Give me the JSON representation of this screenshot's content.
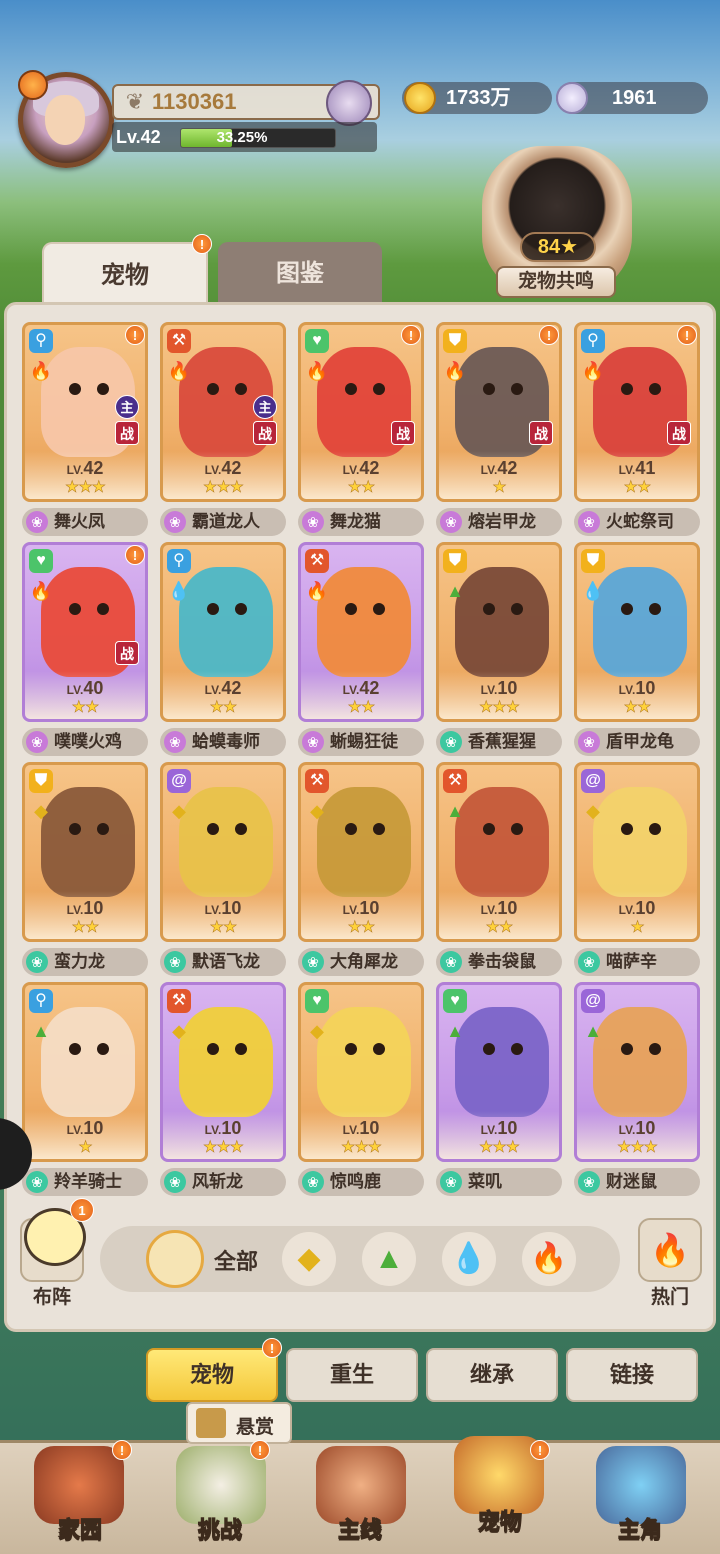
{
  "player": {
    "power": "1130361",
    "level_label": "Lv.42",
    "xp_percent_label": "33.25%",
    "xp_fraction": 0.3325
  },
  "currencies": {
    "gold": "1733万",
    "shell": "1961"
  },
  "resonance": {
    "level": "84★",
    "label": "宠物共鸣"
  },
  "tabs": {
    "pets": "宠物",
    "dex": "图鉴"
  },
  "pets": [
    {
      "name": "舞火凤",
      "level": "42",
      "stars": "★★★",
      "role": "key",
      "element": "fire",
      "zhu": "主",
      "zhan": "战",
      "purple": false,
      "badge": true,
      "body": "#f7c6a8"
    },
    {
      "name": "霸道龙人",
      "level": "42",
      "stars": "★★★",
      "role": "axe",
      "element": "fire",
      "zhu": "主",
      "zhan": "战",
      "purple": false,
      "badge": false,
      "body": "#d94b3c"
    },
    {
      "name": "舞龙猫",
      "level": "42",
      "stars": "★★",
      "role": "heart",
      "element": "fire",
      "zhu": "",
      "zhan": "战",
      "purple": false,
      "badge": true,
      "body": "#e2443a"
    },
    {
      "name": "熔岩甲龙",
      "level": "42",
      "stars": "★",
      "role": "shield",
      "element": "fire",
      "zhu": "",
      "zhan": "战",
      "purple": false,
      "badge": true,
      "body": "#6b5a55"
    },
    {
      "name": "火蛇祭司",
      "level": "41",
      "stars": "★★",
      "role": "key",
      "element": "fire",
      "zhu": "",
      "zhan": "战",
      "purple": false,
      "badge": true,
      "body": "#d9423c"
    },
    {
      "name": "噗噗火鸡",
      "level": "40",
      "stars": "★★",
      "role": "heart",
      "element": "fire",
      "zhu": "",
      "zhan": "战",
      "purple": true,
      "badge": true,
      "body": "#e94b3a"
    },
    {
      "name": "蛤蟆毒师",
      "level": "42",
      "stars": "★★",
      "role": "key",
      "element": "water",
      "zhu": "",
      "zhan": "",
      "purple": false,
      "badge": false,
      "body": "#4cb7c7"
    },
    {
      "name": "蜥蜴狂徒",
      "level": "42",
      "stars": "★★",
      "role": "axe",
      "element": "fire",
      "zhu": "",
      "zhan": "",
      "purple": true,
      "badge": false,
      "body": "#f08a3c"
    },
    {
      "name": "香蕉猩猩",
      "level": "10",
      "stars": "★★★",
      "role": "shield",
      "element": "grass",
      "zhu": "",
      "zhan": "",
      "purple": false,
      "badge": false,
      "body": "#7a4a38"
    },
    {
      "name": "盾甲龙龟",
      "level": "10",
      "stars": "★★",
      "role": "shield",
      "element": "water",
      "zhu": "",
      "zhan": "",
      "purple": false,
      "badge": false,
      "body": "#5aa7d8"
    },
    {
      "name": "蛮力龙",
      "level": "10",
      "stars": "★★",
      "role": "shield",
      "element": "earth",
      "zhu": "",
      "zhan": "",
      "purple": false,
      "badge": false,
      "body": "#8a5a3a"
    },
    {
      "name": "默语飞龙",
      "level": "10",
      "stars": "★★",
      "role": "spiral",
      "element": "earth",
      "zhu": "",
      "zhan": "",
      "purple": false,
      "badge": false,
      "body": "#e8c24a"
    },
    {
      "name": "大角犀龙",
      "level": "10",
      "stars": "★★",
      "role": "axe",
      "element": "earth",
      "zhu": "",
      "zhan": "",
      "purple": false,
      "badge": false,
      "body": "#c79a3a"
    },
    {
      "name": "拳击袋鼠",
      "level": "10",
      "stars": "★★",
      "role": "axe",
      "element": "grass",
      "zhu": "",
      "zhan": "",
      "purple": false,
      "badge": false,
      "body": "#c4583a"
    },
    {
      "name": "喵萨辛",
      "level": "10",
      "stars": "★",
      "role": "spiral",
      "element": "earth",
      "zhu": "",
      "zhan": "",
      "purple": false,
      "badge": false,
      "body": "#f2d26a"
    },
    {
      "name": "羚羊骑士",
      "level": "10",
      "stars": "★",
      "role": "key",
      "element": "grass",
      "zhu": "",
      "zhan": "",
      "purple": false,
      "badge": false,
      "body": "#f4dcc4"
    },
    {
      "name": "风斩龙",
      "level": "10",
      "stars": "★★★",
      "role": "axe",
      "element": "earth",
      "zhu": "",
      "zhan": "",
      "purple": true,
      "badge": false,
      "body": "#f0cf3a"
    },
    {
      "name": "惊鸣鹿",
      "level": "10",
      "stars": "★★★",
      "role": "heart",
      "element": "earth",
      "zhu": "",
      "zhan": "",
      "purple": false,
      "badge": false,
      "body": "#f3d35a"
    },
    {
      "name": "菜叽",
      "level": "10",
      "stars": "★★★",
      "role": "heart",
      "element": "grass",
      "zhu": "",
      "zhan": "",
      "purple": true,
      "badge": false,
      "body": "#7b64c8"
    },
    {
      "name": "财迷鼠",
      "level": "10",
      "stars": "★★★",
      "role": "spiral",
      "element": "grass",
      "zhu": "",
      "zhan": "",
      "purple": true,
      "badge": false,
      "body": "#e7a25a"
    }
  ],
  "filters": {
    "formation": "布阵",
    "formation_badge": "1",
    "all": "全部",
    "hot": "热门"
  },
  "subtabs": {
    "pets": "宠物",
    "rebirth": "重生",
    "inherit": "继承",
    "link": "链接"
  },
  "bounty": "悬赏",
  "nav": {
    "home": "家园",
    "challenge": "挑战",
    "mainline": "主线",
    "pets": "宠物",
    "hero": "主角"
  },
  "colors": {
    "accent_orange": "#f4a33a",
    "card_purple": "#c79be8",
    "badge": "#e2601a"
  }
}
